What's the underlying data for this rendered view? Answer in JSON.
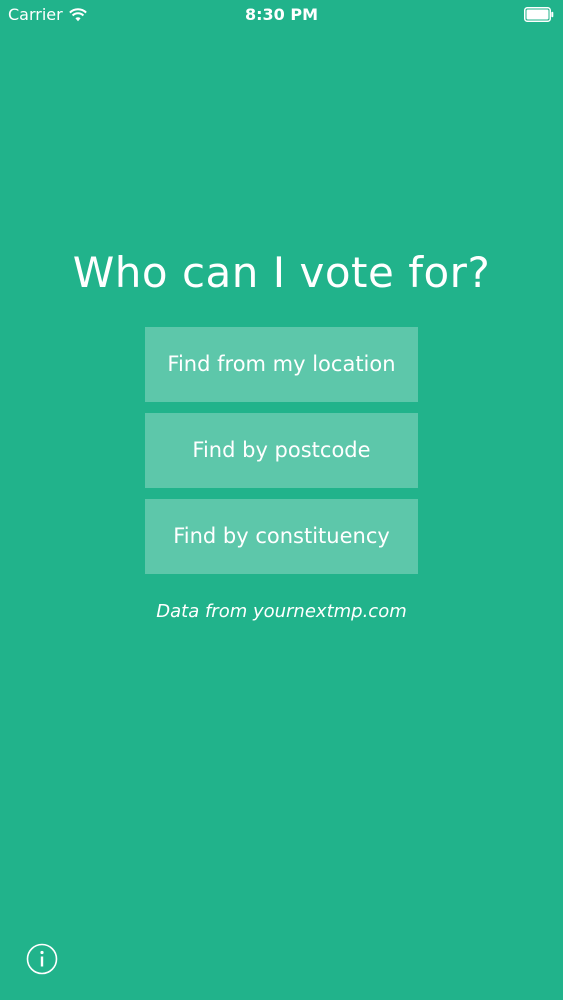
{
  "status_bar": {
    "carrier": "Carrier",
    "time": "8:30 PM",
    "wifi_icon": "wifi-icon",
    "battery_icon": "battery-icon"
  },
  "main": {
    "title": "Who can I vote for?",
    "buttons": [
      {
        "label": "Find from my location"
      },
      {
        "label": "Find by postcode"
      },
      {
        "label": "Find by constituency"
      }
    ],
    "credit": "Data from yournextmp.com",
    "info_icon": "info-icon"
  },
  "colors": {
    "background": "#21b38b",
    "button_background": "rgba(255,255,255,0.27)",
    "text": "#ffffff"
  }
}
